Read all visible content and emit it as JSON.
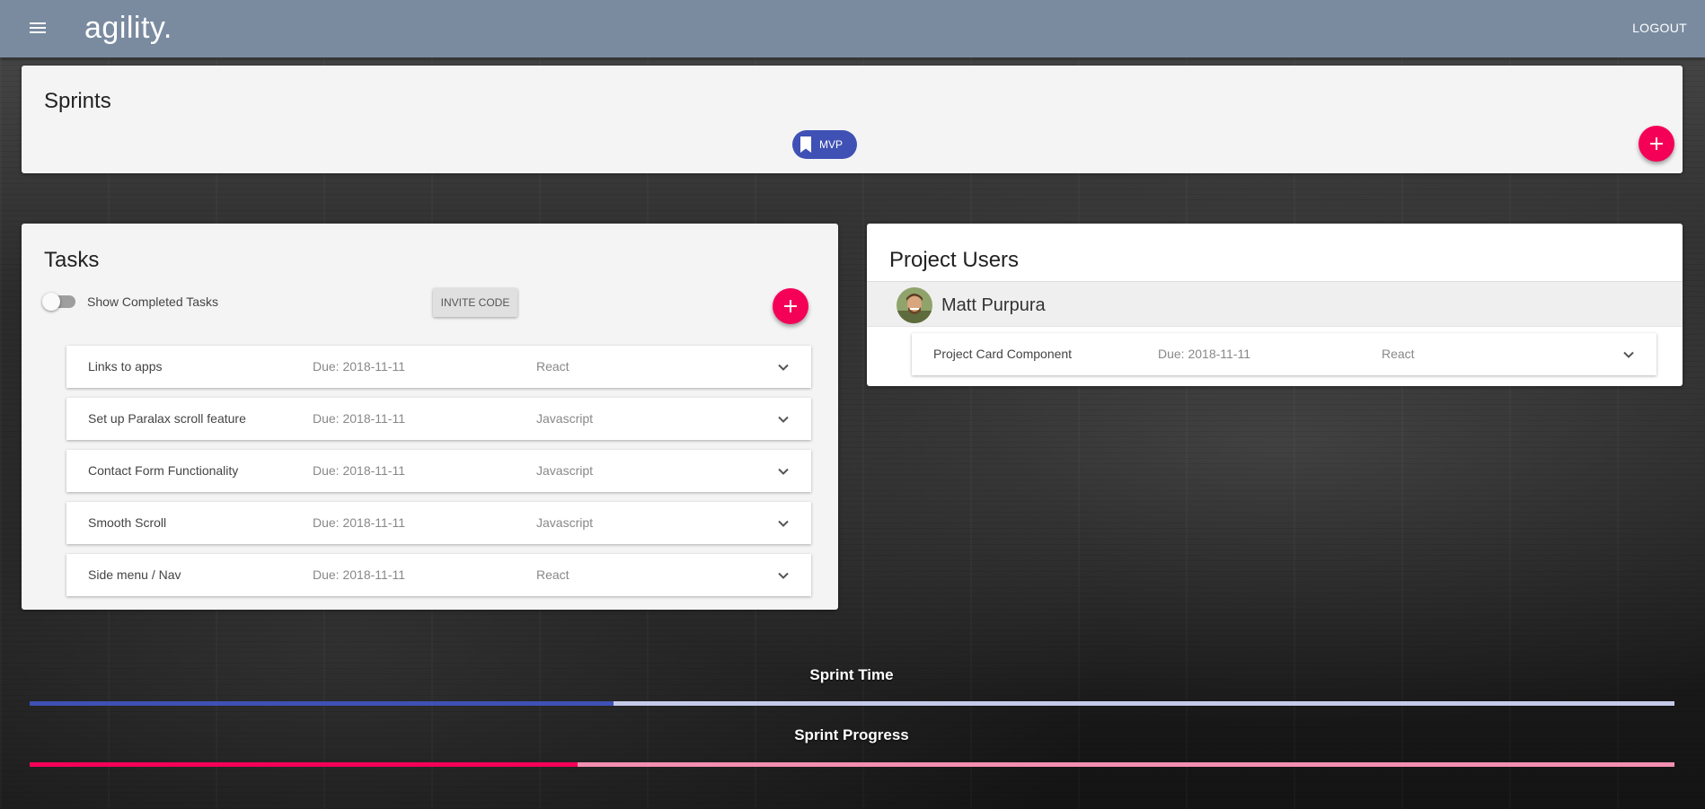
{
  "appbar": {
    "brand": "agility.",
    "logout_label": "LOGOUT"
  },
  "sprints": {
    "title": "Sprints",
    "chips": [
      {
        "label": "MVP",
        "icon": "bookmark-icon"
      }
    ],
    "add_icon": "plus-icon"
  },
  "tasks": {
    "title": "Tasks",
    "toggle_label": "Show Completed Tasks",
    "toggle_on": false,
    "invite_label": "INVITE CODE",
    "add_icon": "plus-icon",
    "items": [
      {
        "name": "Links to apps",
        "due": "Due: 2018-11-11",
        "tag": "React"
      },
      {
        "name": "Set up Paralax scroll feature",
        "due": "Due: 2018-11-11",
        "tag": "Javascript"
      },
      {
        "name": "Contact Form Functionality",
        "due": "Due: 2018-11-11",
        "tag": "Javascript"
      },
      {
        "name": "Smooth Scroll",
        "due": "Due: 2018-11-11",
        "tag": "Javascript"
      },
      {
        "name": "Side menu / Nav",
        "due": "Due: 2018-11-11",
        "tag": "React"
      }
    ]
  },
  "project_users": {
    "title": "Project Users",
    "users": [
      {
        "name": "Matt Purpura",
        "tasks": [
          {
            "name": "Project Card Component",
            "due": "Due: 2018-11-11",
            "tag": "React"
          }
        ]
      }
    ]
  },
  "sprint_time": {
    "label": "Sprint Time",
    "fraction": 0.355
  },
  "sprint_progress": {
    "label": "Sprint Progress",
    "fraction": 0.333
  },
  "colors": {
    "appbar": "#7a8ba0",
    "primary": "#3f51b5",
    "accent": "#f50057"
  }
}
